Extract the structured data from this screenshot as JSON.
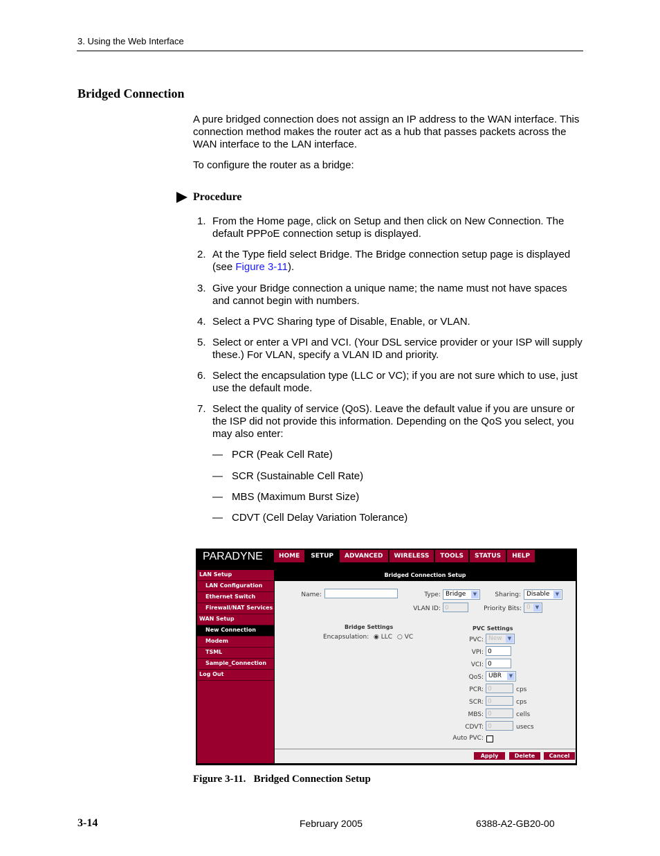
{
  "header": {
    "section": "3. Using the Web Interface"
  },
  "heading": "Bridged Connection",
  "intro": [
    "A pure bridged connection does not assign an IP address to the WAN interface. This connection method makes the router act as a hub that passes packets across the WAN interface to the LAN interface.",
    "To configure the router as a bridge:"
  ],
  "procedure_label": "Procedure",
  "steps": [
    {
      "n": "1.",
      "text": "From the Home page, click on Setup and then click on New Connection. The default PPPoE connection setup is displayed."
    },
    {
      "n": "2.",
      "pre": "At the Type field select Bridge. The Bridge connection setup page is displayed (see ",
      "link": "Figure 3-11",
      "post": ")."
    },
    {
      "n": "3.",
      "text": "Give your Bridge connection a unique name; the name must not have spaces and cannot begin with numbers."
    },
    {
      "n": "4.",
      "text": "Select a PVC Sharing type of Disable, Enable, or VLAN."
    },
    {
      "n": "5.",
      "text": "Select or enter a VPI and VCI. (Your DSL service provider or your ISP will supply these.) For VLAN, specify a VLAN ID and priority."
    },
    {
      "n": "6.",
      "text": "Select the encapsulation type (LLC or VC); if you are not sure which to use, just use the default mode."
    },
    {
      "n": "7.",
      "text": "Select the quality of service (QoS). Leave the default value if you are unsure or the ISP did not provide this information. Depending on the QoS you select, you may also enter:"
    }
  ],
  "sub_items": [
    "PCR (Peak Cell Rate)",
    "SCR (Sustainable Cell Rate)",
    "MBS (Maximum Burst Size)",
    "CDVT (Cell Delay Variation Tolerance)"
  ],
  "dash": "—",
  "screenshot": {
    "logo": "PARADYNE",
    "nav": [
      "HOME",
      "SETUP",
      "ADVANCED",
      "WIRELESS",
      "TOOLS",
      "STATUS",
      "HELP"
    ],
    "nav_active": "SETUP",
    "sidebar": [
      "LAN Setup",
      "LAN Configuration",
      "Ethernet Switch",
      "Firewall/NAT Services",
      "WAN Setup",
      "New Connection",
      "Modem",
      "TSML",
      "Sample_Connection",
      "Log Out"
    ],
    "title": "Bridged Connection Setup",
    "name_label": "Name:",
    "name_value": "",
    "type_label": "Type:",
    "type_value": "Bridge",
    "sharing_label": "Sharing:",
    "sharing_value": "Disable",
    "vlan_label": "VLAN ID:",
    "vlan_value": "0",
    "priority_label": "Priority Bits:",
    "priority_value": "0",
    "bridge_settings": "Bridge Settings",
    "encap_label": "Encapsulation:",
    "encap_llc": "LLC",
    "encap_vc": "VC",
    "pvc_settings": "PVC Settings",
    "pvc_label": "PVC:",
    "pvc_value": "New",
    "vpi_label": "VPI:",
    "vpi_value": "0",
    "vci_label": "VCI:",
    "vci_value": "0",
    "qos_label": "QoS:",
    "qos_value": "UBR",
    "pcr_label": "PCR:",
    "pcr_value": "0",
    "pcr_unit": "cps",
    "scr_label": "SCR:",
    "scr_value": "0",
    "scr_unit": "cps",
    "mbs_label": "MBS:",
    "mbs_value": "0",
    "mbs_unit": "cells",
    "cdvt_label": "CDVT:",
    "cdvt_value": "0",
    "cdvt_unit": "usecs",
    "autopvc_label": "Auto PVC:",
    "buttons": {
      "apply": "Apply",
      "delete": "Delete",
      "cancel": "Cancel"
    }
  },
  "caption": "Figure 3-11.   Bridged Connection Setup",
  "footer": {
    "page": "3-14",
    "date": "February 2005",
    "doc": "6388-A2-GB20-00"
  }
}
